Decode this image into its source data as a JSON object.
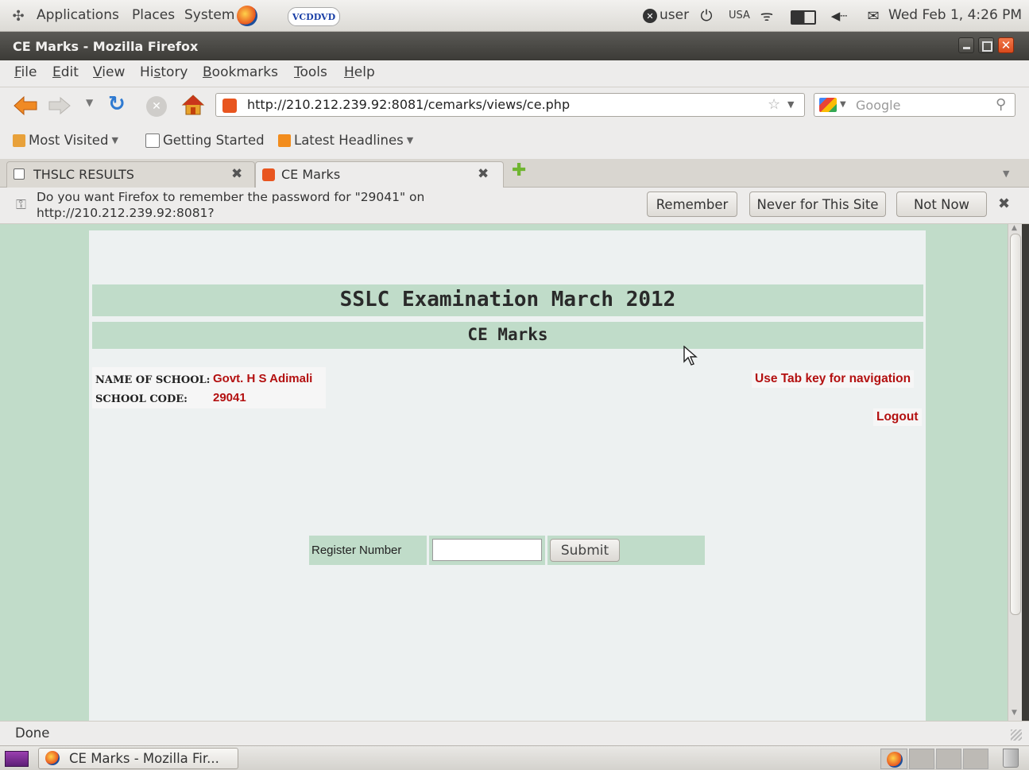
{
  "top_panel": {
    "menus": [
      "Applications",
      "Places",
      "System"
    ],
    "vcd_label": "VCDDVD",
    "user": "user",
    "keyboard": "USA",
    "datetime": "Wed Feb 1,  4:26 PM"
  },
  "window": {
    "title": "CE Marks - Mozilla Firefox"
  },
  "menubar": {
    "items": [
      {
        "first": "F",
        "rest": "ile"
      },
      {
        "first": "E",
        "rest": "dit"
      },
      {
        "first": "V",
        "rest": "iew"
      },
      {
        "pre": "Hi",
        "first": "s",
        "rest": "tory"
      },
      {
        "first": "B",
        "rest": "ookmarks"
      },
      {
        "first": "T",
        "rest": "ools"
      },
      {
        "first": "H",
        "rest": "elp"
      }
    ]
  },
  "navbar": {
    "url": "http://210.212.239.92:8081/cemarks/views/ce.php",
    "search_placeholder": "Google"
  },
  "bookmarks": [
    {
      "label": "Most Visited",
      "dropdown": true
    },
    {
      "label": "Getting Started",
      "dropdown": false
    },
    {
      "label": "Latest Headlines",
      "dropdown": true
    }
  ],
  "tabs": [
    {
      "label": "THSLC RESULTS",
      "active": false
    },
    {
      "label": "CE Marks",
      "active": true
    }
  ],
  "notification": {
    "line1": "Do you want Firefox to remember the password for \"29041\" on",
    "line2": "http://210.212.239.92:8081?",
    "remember": "Remember",
    "never": "Never for This Site",
    "not_now": "Not Now"
  },
  "page": {
    "exam_title": "SSLC Examination March 2012",
    "subtitle": "CE Marks",
    "school_name_label": "NAME OF SCHOOL:",
    "school_name": "Govt. H S Adimali",
    "school_code_label": "SCHOOL CODE:",
    "school_code": "29041",
    "tab_hint": "Use Tab key for navigation",
    "logout": "Logout",
    "register_label": "Register Number",
    "register_value": "",
    "submit": "Submit"
  },
  "status": {
    "text": "Done"
  },
  "taskbar": {
    "window_label": "CE Marks - Mozilla Fir..."
  },
  "colors": {
    "page_bg": "#c1dcc9",
    "band": "#c0dcc9",
    "link_red": "#b31010",
    "close_orange": "#e8551f"
  }
}
